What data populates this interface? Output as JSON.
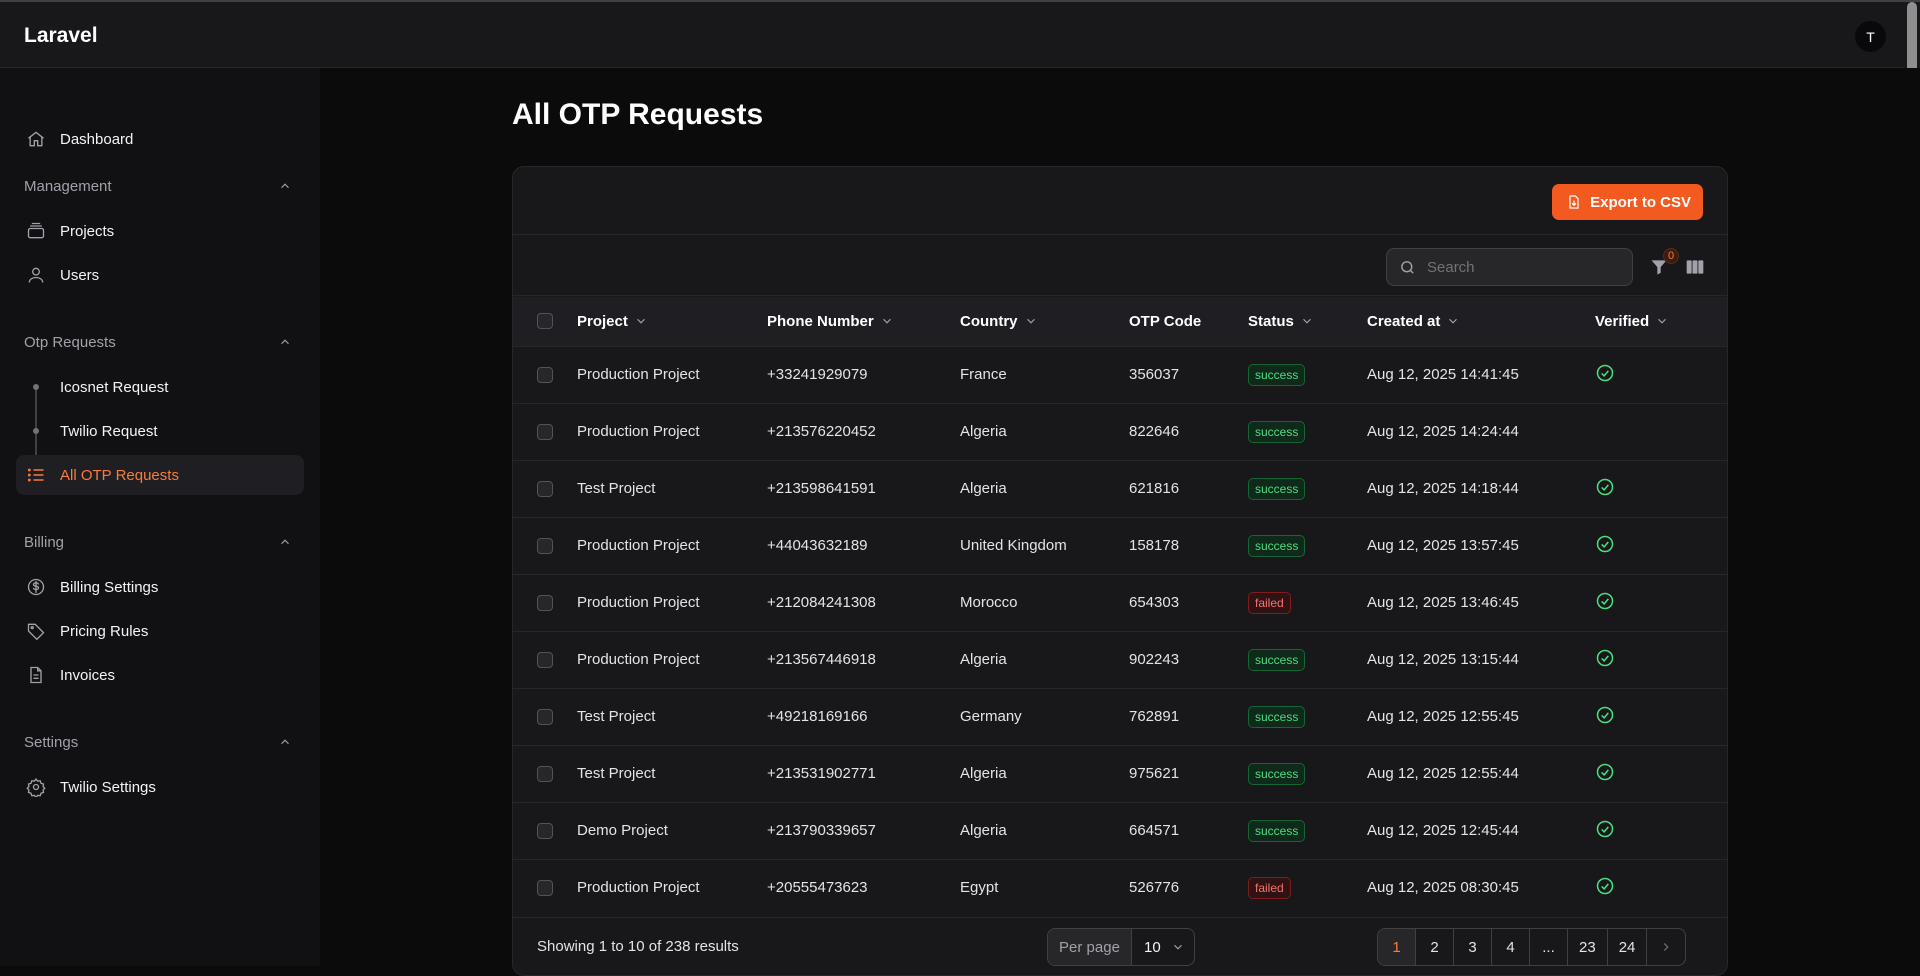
{
  "app": {
    "brand": "Laravel",
    "avatar_initial": "T"
  },
  "sidebar": {
    "dashboard": "Dashboard",
    "groups": {
      "management": {
        "label": "Management",
        "items": {
          "projects": "Projects",
          "users": "Users"
        }
      },
      "otp": {
        "label": "Otp Requests",
        "items": {
          "icosnet": "Icosnet Request",
          "twilio": "Twilio Request",
          "all": "All OTP Requests"
        }
      },
      "billing": {
        "label": "Billing",
        "items": {
          "settings": "Billing Settings",
          "pricing": "Pricing Rules",
          "invoices": "Invoices"
        }
      },
      "settings": {
        "label": "Settings",
        "items": {
          "twilio": "Twilio Settings"
        }
      }
    }
  },
  "page": {
    "title": "All OTP Requests"
  },
  "toolbar": {
    "export_label": "Export to CSV",
    "search_placeholder": "Search",
    "filter_count": "0"
  },
  "table": {
    "headers": {
      "project": "Project",
      "phone": "Phone Number",
      "country": "Country",
      "otp": "OTP Code",
      "status": "Status",
      "created": "Created at",
      "verified": "Verified"
    },
    "rows": [
      {
        "project": "Production Project",
        "phone": "+33241929079",
        "country": "France",
        "otp": "356037",
        "status": "success",
        "created": "Aug 12, 2025 14:41:45",
        "verified": true
      },
      {
        "project": "Production Project",
        "phone": "+213576220452",
        "country": "Algeria",
        "otp": "822646",
        "status": "success",
        "created": "Aug 12, 2025 14:24:44",
        "verified": false
      },
      {
        "project": "Test Project",
        "phone": "+213598641591",
        "country": "Algeria",
        "otp": "621816",
        "status": "success",
        "created": "Aug 12, 2025 14:18:44",
        "verified": true
      },
      {
        "project": "Production Project",
        "phone": "+44043632189",
        "country": "United Kingdom",
        "otp": "158178",
        "status": "success",
        "created": "Aug 12, 2025 13:57:45",
        "verified": true
      },
      {
        "project": "Production Project",
        "phone": "+212084241308",
        "country": "Morocco",
        "otp": "654303",
        "status": "failed",
        "created": "Aug 12, 2025 13:46:45",
        "verified": true
      },
      {
        "project": "Production Project",
        "phone": "+213567446918",
        "country": "Algeria",
        "otp": "902243",
        "status": "success",
        "created": "Aug 12, 2025 13:15:44",
        "verified": true
      },
      {
        "project": "Test Project",
        "phone": "+49218169166",
        "country": "Germany",
        "otp": "762891",
        "status": "success",
        "created": "Aug 12, 2025 12:55:45",
        "verified": true
      },
      {
        "project": "Test Project",
        "phone": "+213531902771",
        "country": "Algeria",
        "otp": "975621",
        "status": "success",
        "created": "Aug 12, 2025 12:55:44",
        "verified": true
      },
      {
        "project": "Demo Project",
        "phone": "+213790339657",
        "country": "Algeria",
        "otp": "664571",
        "status": "success",
        "created": "Aug 12, 2025 12:45:44",
        "verified": true
      },
      {
        "project": "Production Project",
        "phone": "+20555473623",
        "country": "Egypt",
        "otp": "526776",
        "status": "failed",
        "created": "Aug 12, 2025 08:30:45",
        "verified": true
      }
    ]
  },
  "footer": {
    "showing": "Showing 1 to 10 of 238 results",
    "per_page_label": "Per page",
    "per_page_value": "10",
    "pages": [
      "1",
      "2",
      "3",
      "4",
      "...",
      "23",
      "24"
    ],
    "current_page": "1"
  },
  "colors": {
    "accent": "#f35a1f",
    "accent_text": "#fb7a3c",
    "success": "#4ade80",
    "failed": "#f87171"
  }
}
